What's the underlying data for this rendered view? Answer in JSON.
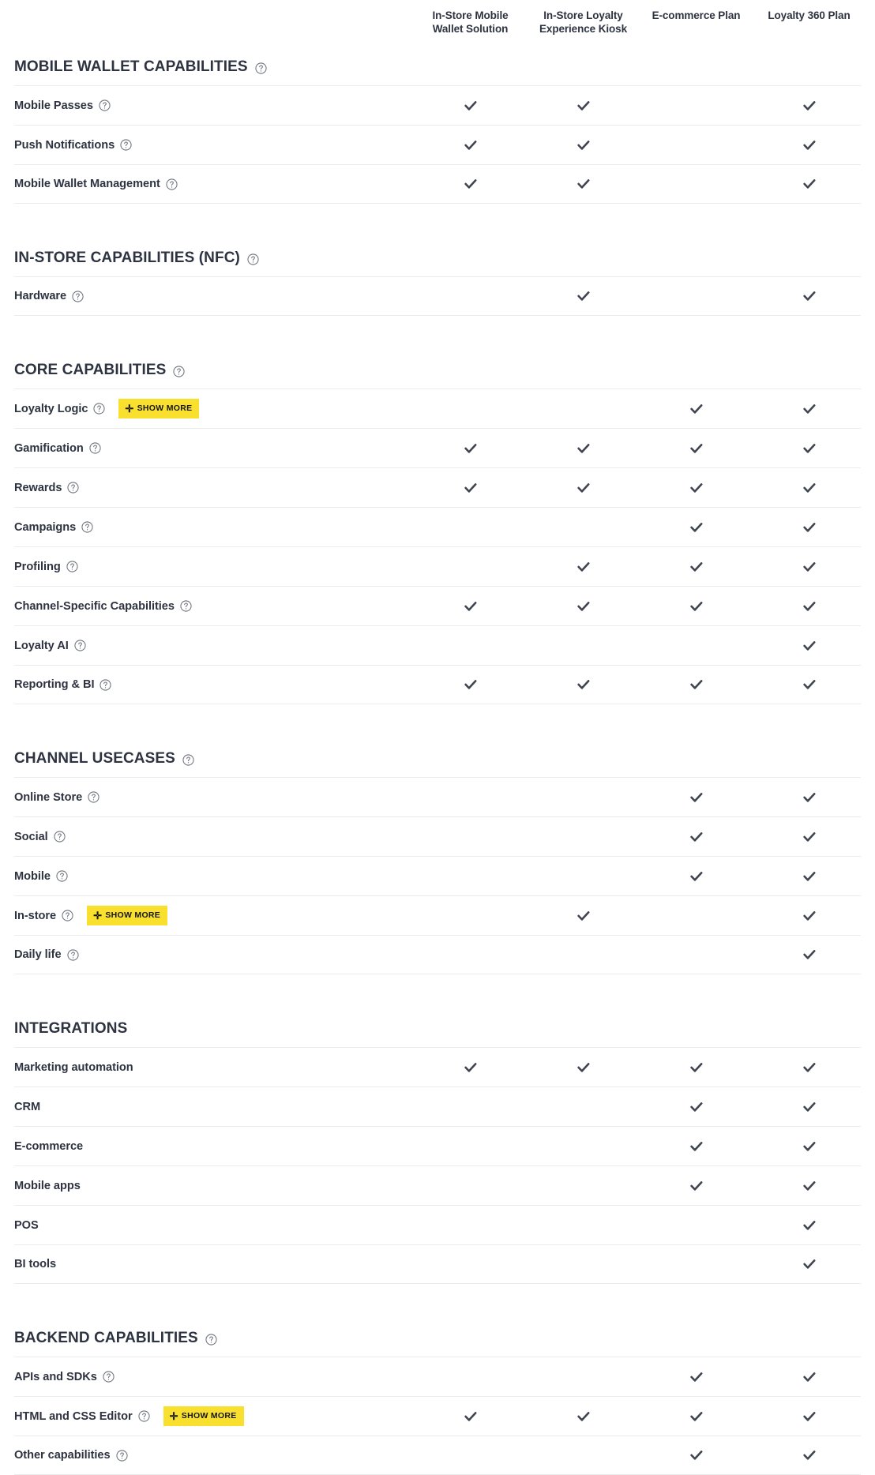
{
  "colors": {
    "accent_yellow": "#FAE02E",
    "text": "#2D3340",
    "check": "#3F4550",
    "rule": "#ECECEC"
  },
  "icons": {
    "help": "help-circle-icon",
    "check": "check-icon",
    "plus": "plus-icon"
  },
  "columns": [
    {
      "label": "In-Store Mobile\nWallet Solution",
      "line1": "In-Store Mobile",
      "line2": "Wallet Solution"
    },
    {
      "label": "In-Store Loyalty\nExperience Kiosk",
      "line1": "In-Store Loyalty",
      "line2": "Experience Kiosk"
    },
    {
      "label": "E-commerce Plan",
      "line1": "E-commerce Plan",
      "line2": ""
    },
    {
      "label": "Loyalty 360 Plan",
      "line1": "Loyalty 360 Plan",
      "line2": ""
    }
  ],
  "show_more_label": "SHOW MORE",
  "plus_glyph": "✛",
  "sections": [
    {
      "title": "MOBILE WALLET CAPABILITIES",
      "has_help": true,
      "rows": [
        {
          "label": "Mobile Passes",
          "has_help": true,
          "show_more": false,
          "checks": [
            true,
            true,
            false,
            true
          ]
        },
        {
          "label": "Push Notifications",
          "has_help": true,
          "show_more": false,
          "checks": [
            true,
            true,
            false,
            true
          ]
        },
        {
          "label": "Mobile Wallet Management",
          "has_help": true,
          "show_more": false,
          "checks": [
            true,
            true,
            false,
            true
          ]
        }
      ]
    },
    {
      "title": "IN-STORE CAPABILITIES (NFC)",
      "has_help": true,
      "rows": [
        {
          "label": "Hardware",
          "has_help": true,
          "show_more": false,
          "checks": [
            false,
            true,
            false,
            true
          ]
        }
      ]
    },
    {
      "title": "CORE CAPABILITIES",
      "has_help": true,
      "rows": [
        {
          "label": "Loyalty Logic",
          "has_help": true,
          "show_more": true,
          "checks": [
            false,
            false,
            true,
            true
          ]
        },
        {
          "label": "Gamification",
          "has_help": true,
          "show_more": false,
          "checks": [
            true,
            true,
            true,
            true
          ]
        },
        {
          "label": "Rewards",
          "has_help": true,
          "show_more": false,
          "checks": [
            true,
            true,
            true,
            true
          ]
        },
        {
          "label": "Campaigns",
          "has_help": true,
          "show_more": false,
          "checks": [
            false,
            false,
            true,
            true
          ]
        },
        {
          "label": "Profiling",
          "has_help": true,
          "show_more": false,
          "checks": [
            false,
            true,
            true,
            true
          ]
        },
        {
          "label": "Channel-Specific Capabilities",
          "has_help": true,
          "show_more": false,
          "checks": [
            true,
            true,
            true,
            true
          ]
        },
        {
          "label": "Loyalty AI",
          "has_help": true,
          "show_more": false,
          "checks": [
            false,
            false,
            false,
            true
          ]
        },
        {
          "label": "Reporting & BI",
          "has_help": true,
          "show_more": false,
          "checks": [
            true,
            true,
            true,
            true
          ]
        }
      ]
    },
    {
      "title": "CHANNEL USECASES",
      "has_help": true,
      "rows": [
        {
          "label": "Online Store",
          "has_help": true,
          "show_more": false,
          "checks": [
            false,
            false,
            true,
            true
          ]
        },
        {
          "label": "Social",
          "has_help": true,
          "show_more": false,
          "checks": [
            false,
            false,
            true,
            true
          ]
        },
        {
          "label": "Mobile",
          "has_help": true,
          "show_more": false,
          "checks": [
            false,
            false,
            true,
            true
          ]
        },
        {
          "label": "In-store",
          "has_help": true,
          "show_more": true,
          "checks": [
            false,
            true,
            false,
            true
          ]
        },
        {
          "label": "Daily life",
          "has_help": true,
          "show_more": false,
          "checks": [
            false,
            false,
            false,
            true
          ]
        }
      ]
    },
    {
      "title": "INTEGRATIONS",
      "has_help": false,
      "rows": [
        {
          "label": "Marketing automation",
          "has_help": false,
          "show_more": false,
          "checks": [
            true,
            true,
            true,
            true
          ]
        },
        {
          "label": "CRM",
          "has_help": false,
          "show_more": false,
          "checks": [
            false,
            false,
            true,
            true
          ]
        },
        {
          "label": "E-commerce",
          "has_help": false,
          "show_more": false,
          "checks": [
            false,
            false,
            true,
            true
          ]
        },
        {
          "label": "Mobile apps",
          "has_help": false,
          "show_more": false,
          "checks": [
            false,
            false,
            true,
            true
          ]
        },
        {
          "label": "POS",
          "has_help": false,
          "show_more": false,
          "checks": [
            false,
            false,
            false,
            true
          ]
        },
        {
          "label": "BI tools",
          "has_help": false,
          "show_more": false,
          "checks": [
            false,
            false,
            false,
            true
          ]
        }
      ]
    },
    {
      "title": "BACKEND CAPABILITIES",
      "has_help": true,
      "rows": [
        {
          "label": "APIs and SDKs",
          "has_help": true,
          "show_more": false,
          "checks": [
            false,
            false,
            true,
            true
          ]
        },
        {
          "label": "HTML and CSS Editor",
          "has_help": true,
          "show_more": true,
          "checks": [
            true,
            true,
            true,
            true
          ]
        },
        {
          "label": "Other capabilities",
          "has_help": true,
          "show_more": false,
          "checks": [
            false,
            false,
            true,
            true
          ]
        }
      ]
    }
  ]
}
